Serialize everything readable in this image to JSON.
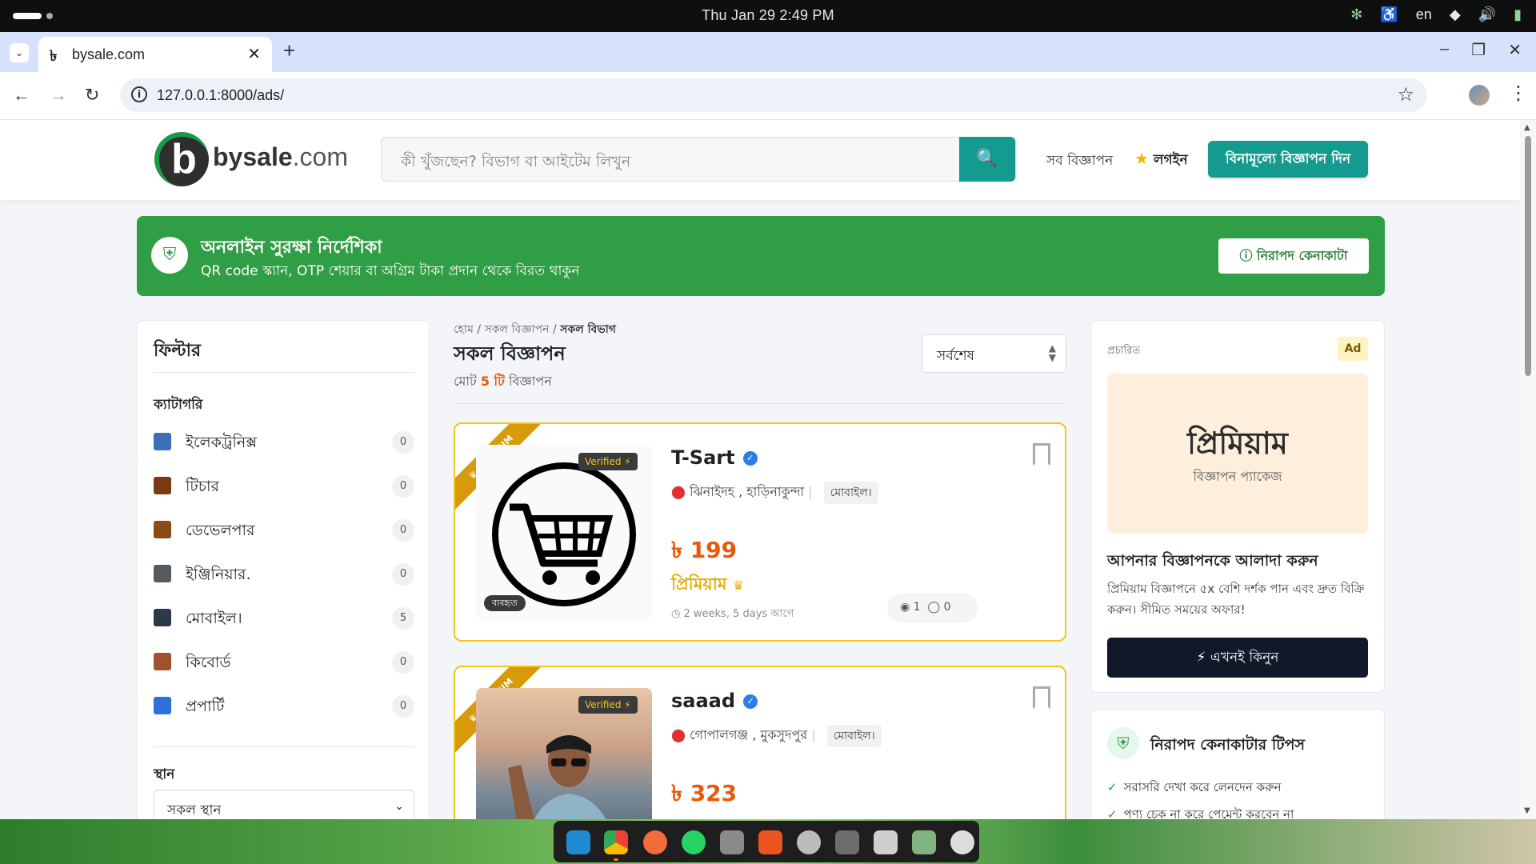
{
  "system": {
    "datetime": "Thu Jan 29   2:49 PM",
    "lang": "en"
  },
  "browser": {
    "tab_title": "bysale.com",
    "favicon": "৳",
    "url": "127.0.0.1:8000/ads/"
  },
  "header": {
    "logo_letter": "b",
    "logo_main": "bysale",
    "logo_tld": ".com",
    "search_placeholder": "কী খুঁজছেন? বিভাগ বা আইটেম লিখুন",
    "nav_all": "সব বিজ্ঞাপন",
    "login": "লগইন",
    "post_ad": "বিনামূল্যে বিজ্ঞাপন দিন"
  },
  "banner": {
    "title": "অনলাইন সুরক্ষা নির্দেশিকা",
    "subtitle": "QR code স্ক্যান, OTP শেয়ার বা অগ্রিম টাকা প্রদান থেকে বিরত থাকুন",
    "button": "নিরাপদ কেনাকাটা"
  },
  "filter": {
    "title": "ফিল্টার",
    "category_heading": "ক্যাটাগরি",
    "categories": [
      {
        "label": "ইলেকট্রনিক্স",
        "count": "0",
        "color": "#3b6fb6"
      },
      {
        "label": "টিচার",
        "count": "0",
        "color": "#7a3b12"
      },
      {
        "label": "ডেভেলপার",
        "count": "0",
        "color": "#8a4a1a"
      },
      {
        "label": "ইঞ্জিনিয়ার.",
        "count": "0",
        "color": "#555a60"
      },
      {
        "label": "মোবাইল।",
        "count": "5",
        "color": "#2a3a4a"
      },
      {
        "label": "কিবোর্ড",
        "count": "0",
        "color": "#a0522d"
      },
      {
        "label": "প্রপার্টি",
        "count": "0",
        "color": "#2e6fd8"
      }
    ],
    "location_heading": "স্থান",
    "location_value": "সকল স্থান"
  },
  "main": {
    "breadcrumb": {
      "home": "হোম",
      "all_ads": "সকল বিজ্ঞাপন",
      "current": "সকল বিভাগ"
    },
    "title": "সকল বিজ্ঞাপন",
    "count_prefix": "মোট",
    "count": "5 টি",
    "count_suffix": "বিজ্ঞাপন",
    "sort_value": "সর্বশেষ",
    "ads": [
      {
        "ribbon": "♛ PREMIUM",
        "verified": "Verified ⚡",
        "condition": "ব্যবহৃত",
        "name": "T-Sart",
        "location": "ঝিনাইদহ , হাড়িনাকুন্দা",
        "category": "মোবাইল।",
        "price": "৳ 199",
        "premium_label": "প্রিমিয়াম",
        "time": "2 weeks, 5 days আগে",
        "views": "1",
        "comments": "0"
      },
      {
        "ribbon": "♛ PREMIUM",
        "verified": "Verified ⚡",
        "name": "saaad",
        "location": "গোপালগঞ্জ , মুকসুদপুর",
        "category": "মোবাইল।",
        "price": "৳ 323"
      }
    ]
  },
  "sidebar": {
    "ad_label": "প্রচারিত",
    "ad_tag": "Ad",
    "art_title": "প্রিমিয়াম",
    "art_sub": "বিজ্ঞাপন প্যাকেজ",
    "heading": "আপনার বিজ্ঞাপনকে আলাদা করুন",
    "desc": "প্রিমিয়াম বিজ্ঞাপনে ৫x বেশি দর্শক পান এবং দ্রুত বিক্রি করুন। সীমিত সময়ের অফার!",
    "buy": "এখনই কিনুন",
    "tips_title": "নিরাপদ কেনাকাটার টিপস",
    "tips": [
      "সরাসরি দেখা করে লেনদেন করুন",
      "পণ্য চেক না করে পেমেন্ট করবেন না"
    ]
  },
  "colors": {
    "brand": "#139b8f",
    "banner": "#2f9e44",
    "price": "#e8590c",
    "premium": "#f5c518"
  }
}
